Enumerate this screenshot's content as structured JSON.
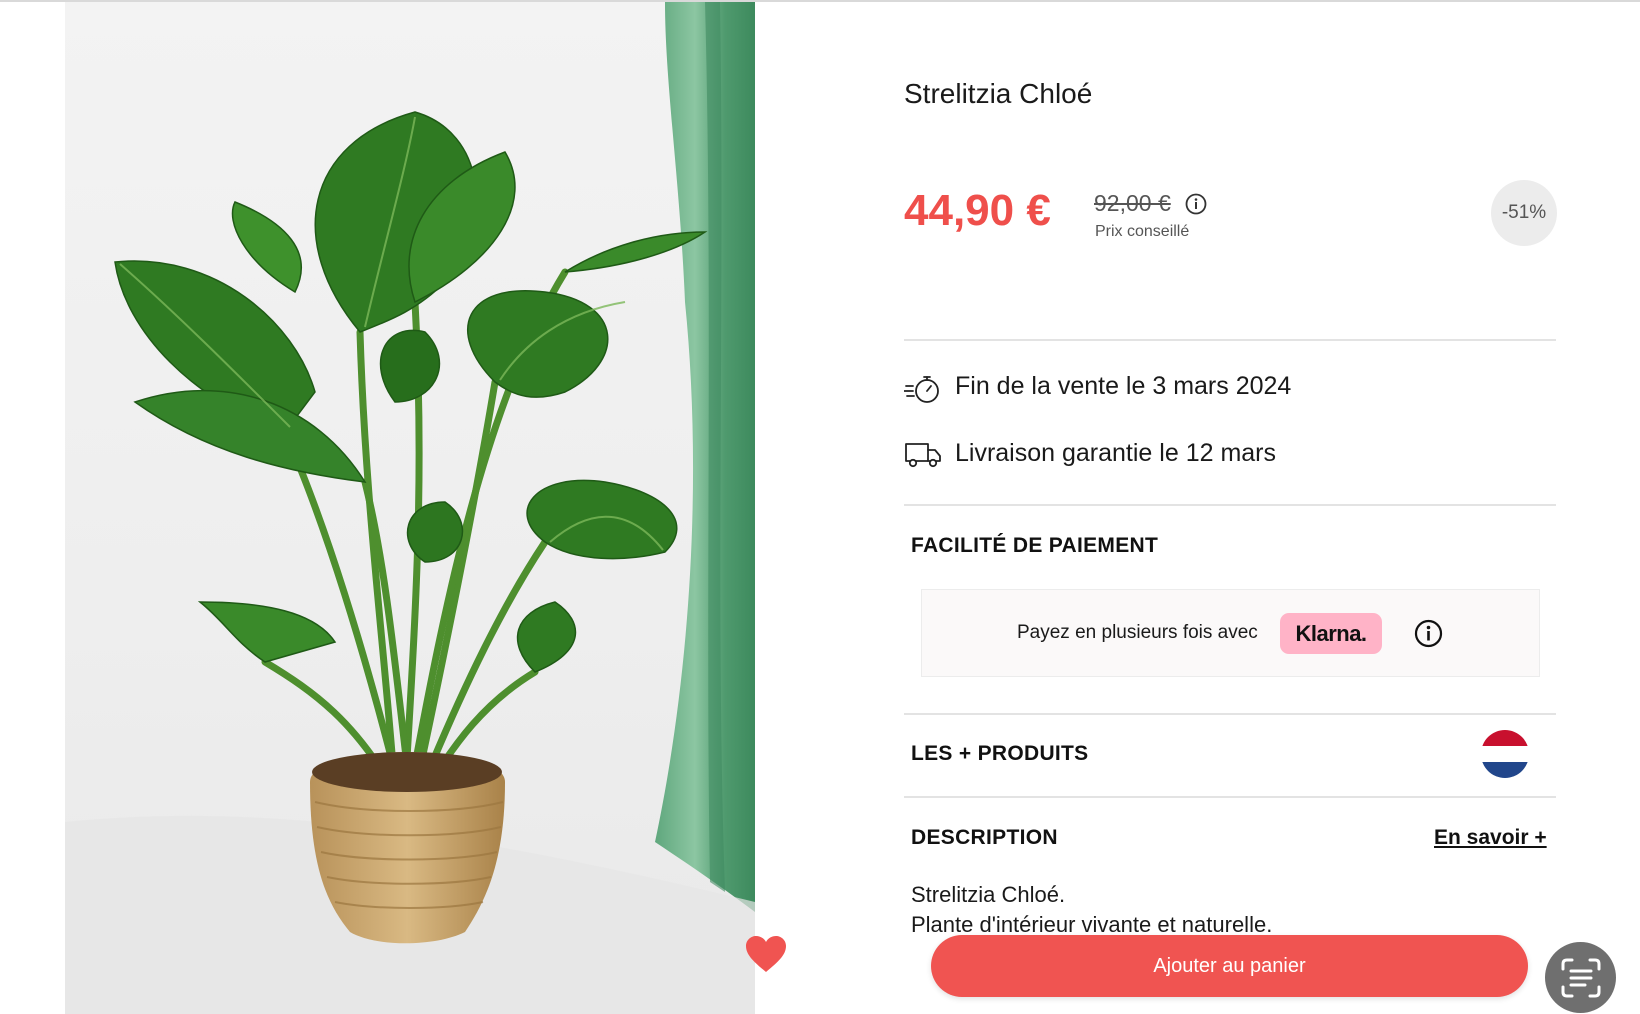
{
  "product": {
    "title": "Strelitzia Chloé",
    "price": "44,90 €",
    "old_price": "92,00 €",
    "price_note": "Prix conseillé",
    "discount": "-51%"
  },
  "info_rows": [
    {
      "icon": "stopwatch-icon",
      "text": "Fin de la vente le 3 mars 2024"
    },
    {
      "icon": "delivery-truck-icon",
      "text": "Livraison garantie le 12 mars"
    }
  ],
  "payment": {
    "section_title": "FACILITÉ DE PAIEMENT",
    "text": "Payez en plusieurs fois avec",
    "provider": "Klarna."
  },
  "extras": {
    "section_title": "LES + PRODUITS",
    "flag_icon": "netherlands-flag-icon"
  },
  "description": {
    "section_title": "DESCRIPTION",
    "more_link": "En savoir +",
    "lines": [
      "Strelitzia Chloé.",
      "Plante d'intérieur vivante et naturelle."
    ]
  },
  "actions": {
    "add_to_cart": "Ajouter au panier",
    "favorite_icon": "heart-icon",
    "scan_icon": "scan-icon"
  },
  "colors": {
    "accent": "#f05451",
    "price": "#ef4f4b",
    "klarna": "#ffb3c7"
  }
}
